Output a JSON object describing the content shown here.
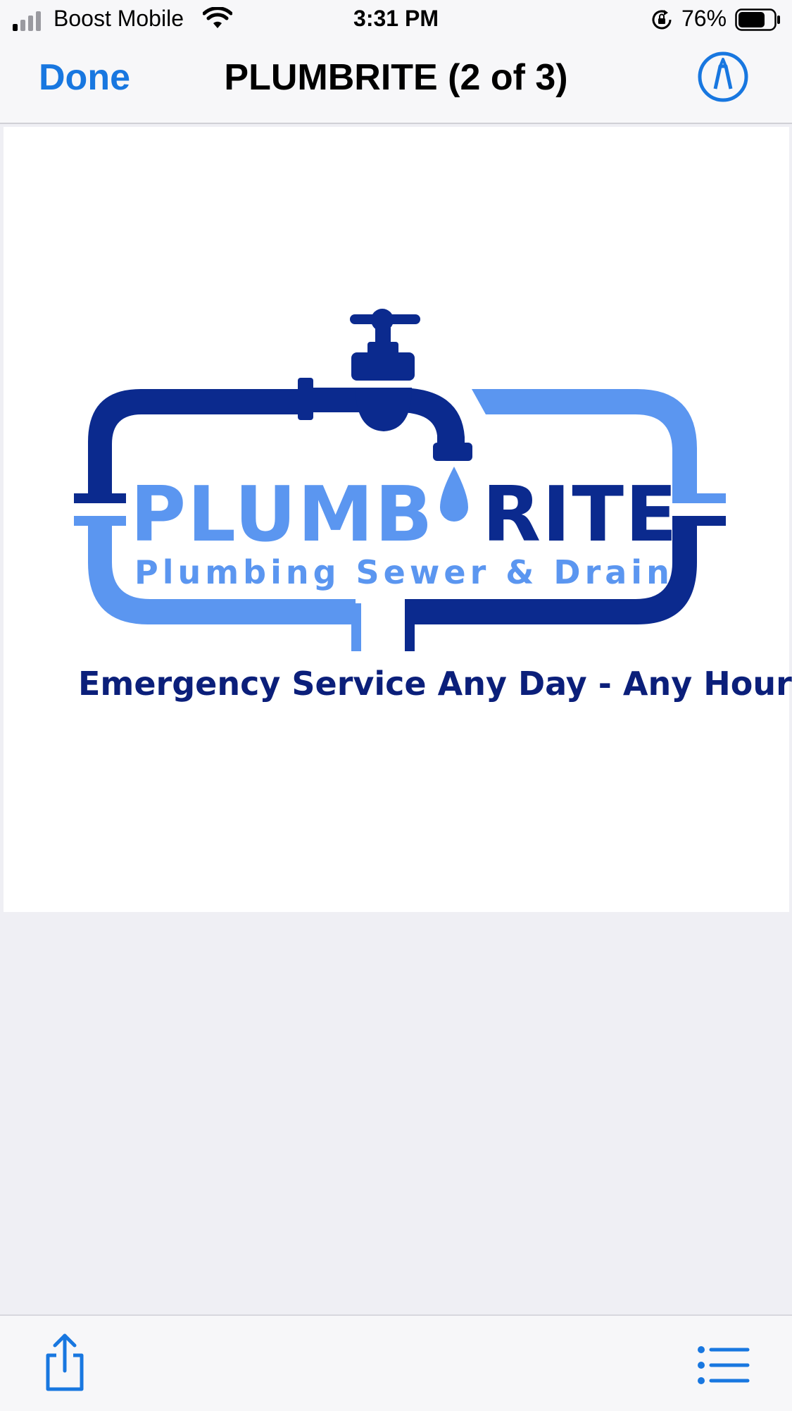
{
  "status_bar": {
    "carrier": "Boost Mobile",
    "time": "3:31 PM",
    "battery_percent": "76%",
    "signal_icon": "signal-bars-icon",
    "wifi_icon": "wifi-icon",
    "rotation_lock_icon": "rotation-lock-icon",
    "battery_icon": "battery-icon",
    "battery_level": 0.76
  },
  "nav_bar": {
    "done_label": "Done",
    "title": "PLUMBRITE (2 of 3)",
    "markup_icon": "markup-pen-icon"
  },
  "image": {
    "brand_left": "PLUMB",
    "brand_right": "RITE",
    "subtitle": "Plumbing Sewer & Drain",
    "tagline": "Emergency Service Any Day - Any Hour",
    "colors": {
      "dark_blue": "#0b2a8e",
      "light_blue": "#5b96f0"
    }
  },
  "toolbar": {
    "share_icon": "share-icon",
    "list_icon": "list-icon"
  },
  "colors": {
    "accent": "#1877e0",
    "background": "#efeff4",
    "bar": "#f7f7f9"
  }
}
